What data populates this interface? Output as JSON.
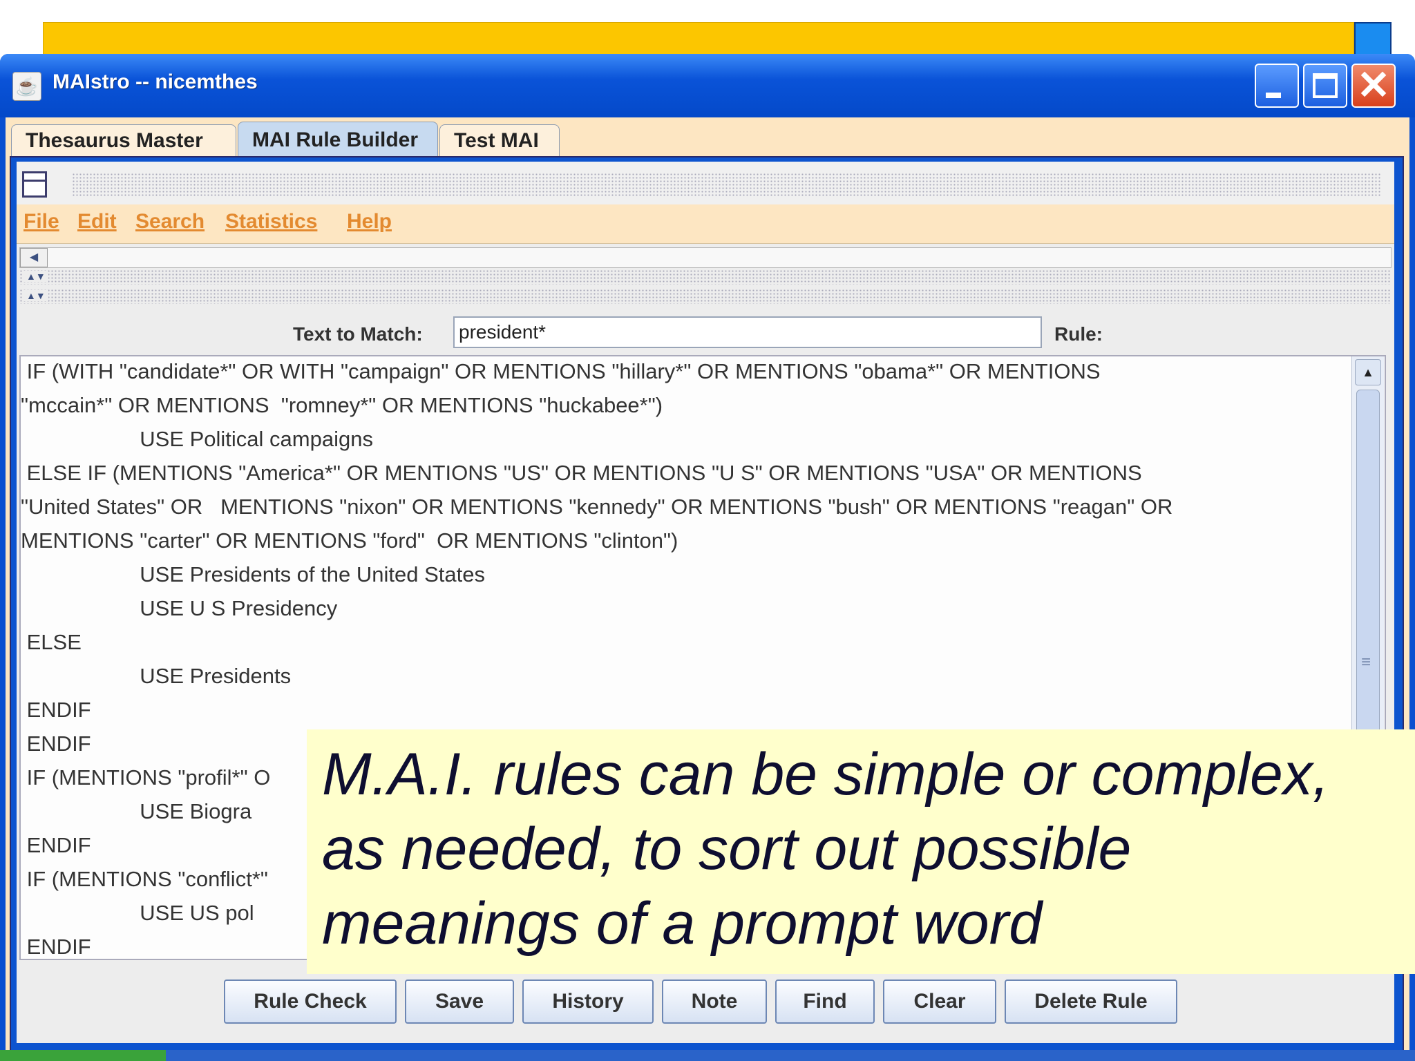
{
  "window": {
    "title": "MAIstro -- nicemthes",
    "icon": "java-cup-icon",
    "controls": [
      "minimize-icon",
      "maximize-icon",
      "close-icon"
    ]
  },
  "tabs": [
    "Thesaurus Master",
    "MAI Rule Builder",
    "Test MAI"
  ],
  "active_tab": "MAI Rule Builder",
  "menu": [
    "File",
    "Edit",
    "Search",
    "Statistics",
    "Help"
  ],
  "menu_accent_color": "#e38a30",
  "match": {
    "label": "Text to Match:",
    "value": "president*",
    "rule_label": "Rule:"
  },
  "rule_lines": [
    " IF (WITH \"candidate*\" OR WITH \"campaign\" OR MENTIONS \"hillary*\" OR MENTIONS \"obama*\" OR MENTIONS",
    "\"mccain*\" OR MENTIONS  \"romney*\" OR MENTIONS \"huckabee*\")",
    "                    USE Political campaigns",
    " ELSE IF (MENTIONS \"America*\" OR MENTIONS \"US\" OR MENTIONS \"U S\" OR MENTIONS \"USA\" OR MENTIONS",
    "\"United States\" OR   MENTIONS \"nixon\" OR MENTIONS \"kennedy\" OR MENTIONS \"bush\" OR MENTIONS \"reagan\" OR",
    "MENTIONS \"carter\" OR MENTIONS \"ford\"  OR MENTIONS \"clinton\")",
    "                    USE Presidents of the United States",
    "                    USE U S Presidency",
    " ELSE",
    "                    USE Presidents",
    " ENDIF",
    " ENDIF",
    " IF (MENTIONS \"profil*\" O",
    "                    USE Biogra",
    " ENDIF",
    " IF (MENTIONS \"conflict*\"",
    "                    USE US pol",
    " ENDIF"
  ],
  "caption": {
    "lines": [
      "M.A.I. rules can be simple or complex,",
      "as needed, to sort out possible",
      "meanings of a prompt word"
    ],
    "background": "#ffffcc"
  },
  "buttons": [
    "Rule Check",
    "Save",
    "History",
    "Note",
    "Find",
    "Clear",
    "Delete Rule"
  ]
}
